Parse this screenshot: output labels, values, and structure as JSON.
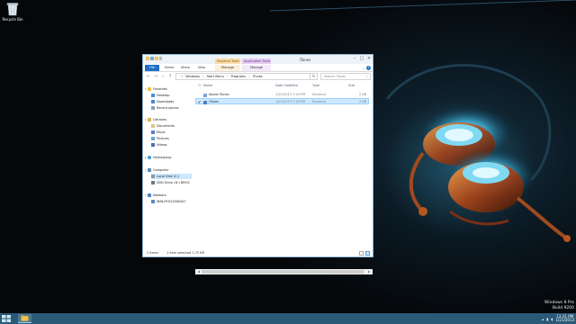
{
  "desktop": {
    "recycle_bin_label": "Recycle Bin"
  },
  "watermark": {
    "line1": "Windows 8 Pro",
    "line2": "Build 9200"
  },
  "window": {
    "title": "iTunes",
    "context_groups": {
      "shortcut_tools": "Shortcut Tools",
      "application_tools": "Application Tools"
    },
    "ribbon_tabs": [
      "File",
      "Home",
      "Share",
      "View",
      "Manage",
      "Manage"
    ],
    "address_path": [
      "Windows",
      "Start Menu",
      "Programs",
      "iTunes"
    ],
    "search_placeholder": "Search iTunes",
    "columns": {
      "name": "Name",
      "date": "Date modified",
      "type": "Type",
      "size": "Size"
    },
    "files": [
      {
        "name": "About iTunes",
        "date": "1/21/2013 7:43 PM",
        "type": "Shortcut",
        "size": "2 KB",
        "selected": false
      },
      {
        "name": "iTunes",
        "date": "1/21/2013 7:43 PM",
        "type": "Shortcut",
        "size": "2 KB",
        "selected": true
      }
    ],
    "nav": {
      "favorites": "Favorites",
      "desktop": "Desktop",
      "downloads": "Downloads",
      "recent_places": "Recent places",
      "libraries": "Libraries",
      "documents": "Documents",
      "music": "Music",
      "pictures": "Pictures",
      "videos": "Videos",
      "homegroup": "Homegroup",
      "computer": "Computer",
      "local_disk": "Local Disk (C:)",
      "dvd_drive": "DVD Drive (D:) BROC",
      "network": "Network",
      "network_pc": "WIN-FEO2OS8I447"
    },
    "status": {
      "items": "2 items",
      "selected": "1 item selected  1.75 KB"
    }
  },
  "taskbar": {
    "time": "12:31 PM",
    "date": "1/21/2013"
  },
  "colors": {
    "file_tab": "#1f6fc5",
    "selection": "#cce8ff",
    "taskbar": "#2b5a78"
  }
}
